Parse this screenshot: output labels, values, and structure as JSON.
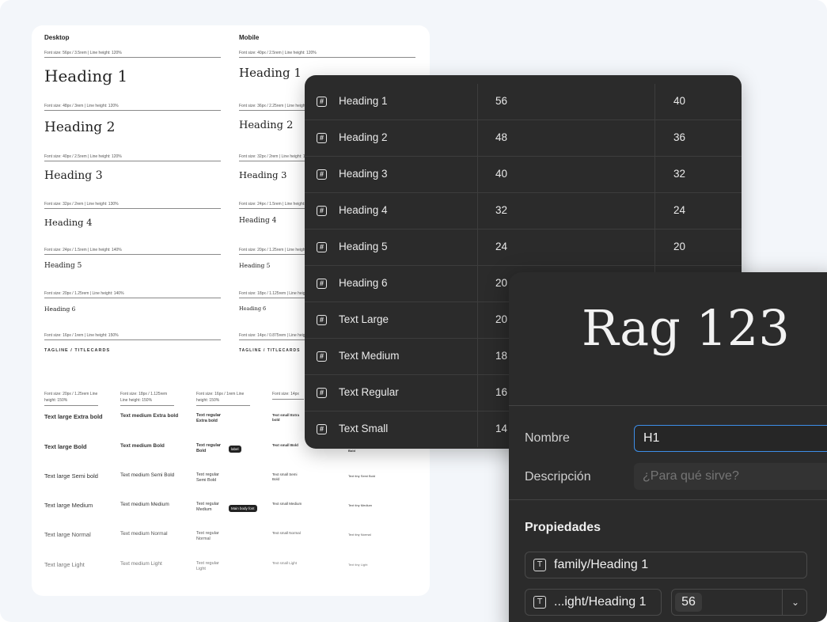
{
  "sheet": {
    "desktop_label": "Desktop",
    "mobile_label": "Mobile",
    "desktop": [
      {
        "meta": "Font size: 56px / 3.5rem | Line height: 120%",
        "name": "Heading 1"
      },
      {
        "meta": "Font size: 48px / 3rem | Line height: 120%",
        "name": "Heading 2"
      },
      {
        "meta": "Font size: 40px / 2.5rem | Line height: 120%",
        "name": "Heading 3"
      },
      {
        "meta": "Font size: 32px / 2rem | Line height: 130%",
        "name": "Heading 4"
      },
      {
        "meta": "Font size: 24px / 1.5rem | Line height: 140%",
        "name": "Heading 5"
      },
      {
        "meta": "Font size: 20px / 1.25rem | Line height: 140%",
        "name": "Heading 6"
      },
      {
        "meta": "Font size: 16px / 1rem | Line height: 150%",
        "name": "TAGLINE / TITLECARDS"
      }
    ],
    "mobile": [
      {
        "meta": "Font size: 40px / 2.5rem | Line height: 120%",
        "name": "Heading 1"
      },
      {
        "meta": "Font size: 36px / 2.25rem | Line height: 120%",
        "name": "Heading 2"
      },
      {
        "meta": "Font size: 32px / 2rem | Line height: 120%",
        "name": "Heading 3"
      },
      {
        "meta": "Font size: 24px / 1.5rem | Line height: 130%",
        "name": "Heading 4"
      },
      {
        "meta": "Font size: 20px / 1.25rem | Line height: 140%",
        "name": "Heading 5"
      },
      {
        "meta": "Font size: 18px / 1.125rem | Line height: 140%",
        "name": "Heading 6"
      },
      {
        "meta": "Font size: 14px / 0.875rem | Line height: 150%",
        "name": "TAGLINE / TITLECARDS"
      }
    ],
    "text_cols": [
      {
        "meta": "Font size: 20px / 1.25rem Line height: 150%",
        "items": [
          "Text large Extra bold",
          "Text large Bold",
          "Text large Semi bold",
          "Text large Medium",
          "Text large Normal",
          "Text large Light"
        ]
      },
      {
        "meta": "Font size: 18px / 1.125rem Line height: 150%",
        "items": [
          "Text medium Extra bold",
          "Text medium Bold",
          "Text medium Semi Bold",
          "Text medium Medium",
          "Text medium Normal",
          "Text medium Light"
        ]
      },
      {
        "meta": "Font size: 16px / 1rem Line height: 150%",
        "items": [
          "Text regular Extra bold",
          "Text regular Bold",
          "Text regular Semi Bold",
          "Text regular Medium",
          "Text regular Normal",
          "Text regular Light"
        ]
      },
      {
        "meta": "Font size: 14px",
        "items": [
          "Text small Extra bold",
          "Text small Bold",
          "Text small Semi Bold",
          "Text small Medium",
          "Text small Normal",
          "Text small Light"
        ]
      },
      {
        "meta": "",
        "items": [
          "",
          "Bold",
          "Text tiny Semi Bold",
          "Text tiny Medium",
          "Text tiny Normal",
          "Text tiny Light"
        ]
      }
    ],
    "chip_label": "label",
    "chip_main": "Main body font"
  },
  "table": {
    "rows": [
      {
        "name": "Heading 1",
        "desktop": "56",
        "mobile": "40"
      },
      {
        "name": "Heading 2",
        "desktop": "48",
        "mobile": "36"
      },
      {
        "name": "Heading 3",
        "desktop": "40",
        "mobile": "32"
      },
      {
        "name": "Heading 4",
        "desktop": "32",
        "mobile": "24"
      },
      {
        "name": "Heading 5",
        "desktop": "24",
        "mobile": "20"
      },
      {
        "name": "Heading 6",
        "desktop": "20",
        "mobile": ""
      },
      {
        "name": "Text Large",
        "desktop": "20",
        "mobile": ""
      },
      {
        "name": "Text Medium",
        "desktop": "18",
        "mobile": ""
      },
      {
        "name": "Text Regular",
        "desktop": "16",
        "mobile": ""
      },
      {
        "name": "Text Small",
        "desktop": "14",
        "mobile": ""
      }
    ]
  },
  "panel": {
    "preview_text": "Rag 123",
    "name_label": "Nombre",
    "name_value": "H1",
    "desc_label": "Descripción",
    "desc_placeholder": "¿Para qué sirve?",
    "props_title": "Propiedades",
    "prop_family": "family/Heading 1",
    "prop_weight": "...ight/Heading 1",
    "prop_size": "56"
  },
  "colors": {
    "accent": "#3d8ee8",
    "dark_panel": "#2b2b2b",
    "background": "#f3f6fa"
  }
}
